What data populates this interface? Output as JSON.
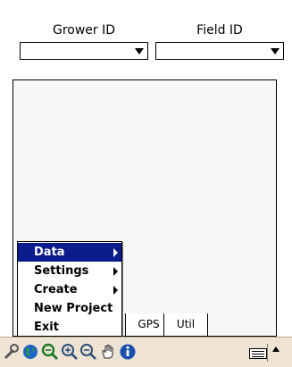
{
  "header": {
    "grower_label": "Grower ID",
    "field_label": "Field ID"
  },
  "tabs": [
    "GPS",
    "Util"
  ],
  "menu": {
    "items": [
      {
        "label": "Data",
        "selected": true,
        "submenu": true
      },
      {
        "label": "Settings",
        "selected": false,
        "submenu": true
      },
      {
        "label": "Create",
        "selected": false,
        "submenu": true
      },
      {
        "label": "New Project",
        "selected": false,
        "submenu": false
      },
      {
        "label": "Exit",
        "selected": false,
        "submenu": false
      }
    ]
  },
  "toolbar": {
    "icons": [
      "wrench-icon",
      "globe-icon",
      "zoom-extent-icon",
      "zoom-in-icon",
      "zoom-out-icon",
      "pan-hand-icon",
      "info-icon",
      "keyboard-icon",
      "input-arrow-icon"
    ]
  },
  "colors": {
    "menu_highlight": "#0a1b8c",
    "toolbar_bg": "#efe3d4",
    "map_bg": "#f6f8f5"
  }
}
